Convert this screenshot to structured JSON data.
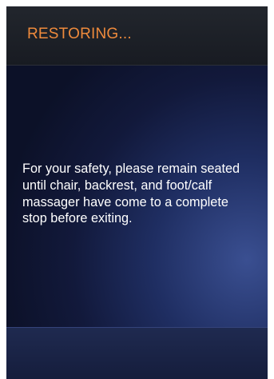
{
  "header": {
    "title": "RESTORING..."
  },
  "main": {
    "message": "For your safety, please remain seated until chair, backrest, and foot/calf massager have come to a complete stop before exiting."
  },
  "colors": {
    "title": "#ee8a3c",
    "message": "#ffffff",
    "background": "#1f2e62"
  }
}
